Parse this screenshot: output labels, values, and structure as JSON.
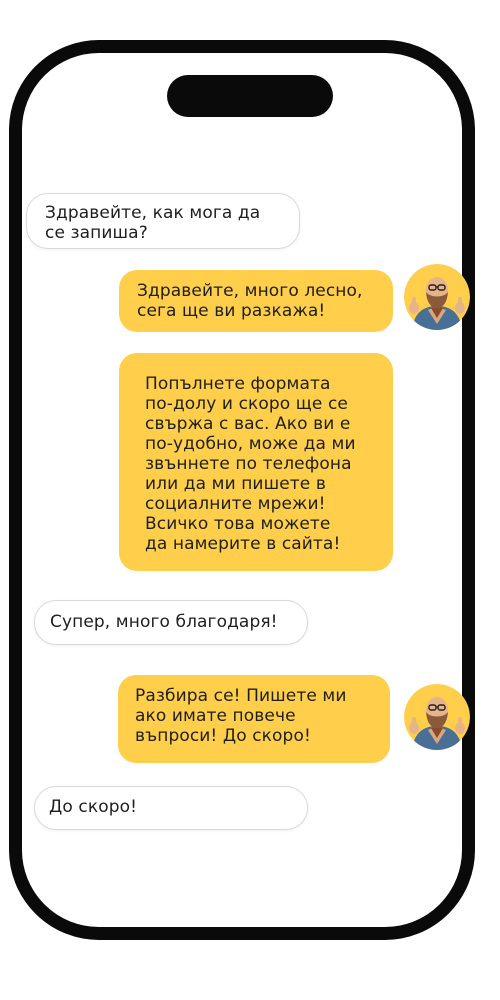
{
  "colors": {
    "frame": "#0a0a0a",
    "screen": "#ffffff",
    "outgoing_bubble": "#ffcf4b",
    "incoming_border": "#d9d9d9",
    "text": "#1e1e1e"
  },
  "messages": [
    {
      "side": "incoming",
      "text": "Здравейте, как мога да\nсе запиша?"
    },
    {
      "side": "outgoing",
      "avatar": "bearded-man-thumbs-up-avatar",
      "text": "Здравейте, много лесно,\nсега ще ви разкажа!"
    },
    {
      "side": "outgoing",
      "text": "Попълнете формата\nпо-долу и скоро ще се\nсвържа с вас. Ако ви е\nпо-удобно, може да ми\nзвъннете по телефона\nили да ми пишете в\nсоциалните мрежи!\nВсичко това можете\nда намерите в сайта!"
    },
    {
      "side": "incoming",
      "text": "Супер, много благодаря!"
    },
    {
      "side": "outgoing",
      "avatar": "bearded-man-thumbs-up-avatar",
      "text": "Разбира се! Пишете ми\nако имате повече\nвъпроси! До скоро!"
    },
    {
      "side": "incoming",
      "text": "До скоро!"
    }
  ]
}
